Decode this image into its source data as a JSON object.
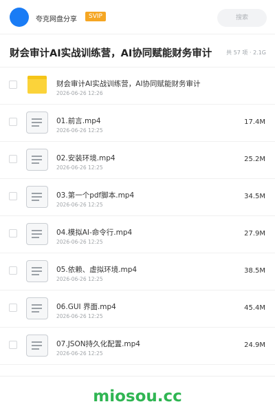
{
  "header": {
    "brand": "夸克网盘分享",
    "badge": "SVIP",
    "search_placeholder": "搜索"
  },
  "folder": {
    "title": "财会审计AI实战训练营，AI协同赋能财务审计",
    "meta": "共 57 项 · 2.1G"
  },
  "items": [
    {
      "type": "folder",
      "name": "财会审计AI实战训练营，AI协同赋能财务审计",
      "date": "2026-06-26 12:26",
      "size": ""
    },
    {
      "type": "file",
      "name": "01.前言.mp4",
      "date": "2026-06-26 12:25",
      "size": "17.4M"
    },
    {
      "type": "file",
      "name": "02.安装环境.mp4",
      "date": "2026-06-26 12:25",
      "size": "25.2M"
    },
    {
      "type": "file",
      "name": "03.第一个pdf脚本.mp4",
      "date": "2026-06-26 12:25",
      "size": "34.5M"
    },
    {
      "type": "file",
      "name": "04.模拟AI-命令行.mp4",
      "date": "2026-06-26 12:25",
      "size": "27.9M"
    },
    {
      "type": "file",
      "name": "05.依赖、虚拟环境.mp4",
      "date": "2026-06-26 12:25",
      "size": "38.5M"
    },
    {
      "type": "file",
      "name": "06.GUI 界面.mp4",
      "date": "2026-06-26 12:25",
      "size": "45.4M"
    },
    {
      "type": "file",
      "name": "07.JSON持久化配置.mp4",
      "date": "2026-06-26 12:25",
      "size": "24.9M"
    }
  ],
  "watermark": "miosou.cc",
  "colors": {
    "accent": "#1a7cf5",
    "badge": "#f5a623",
    "folder": "#fbd33a",
    "watermark": "#2fb552"
  }
}
